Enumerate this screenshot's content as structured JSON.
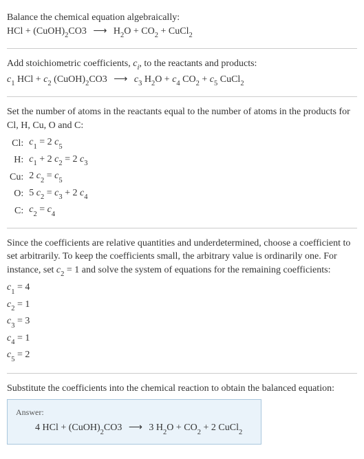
{
  "section1": {
    "line1": "Balance the chemical equation algebraically:"
  },
  "section2": {
    "line1_a": "Add stoichiometric coefficients, ",
    "line1_b": ", to the reactants and products:"
  },
  "section3": {
    "line1": "Set the number of atoms in the reactants equal to the number of atoms in the products for Cl, H, Cu, O and C:",
    "rows": [
      {
        "el": "Cl:",
        "eq_lhs": "c",
        "eq_s1": "1",
        "eq_mid": " = 2 ",
        "eq_rhs": "c",
        "eq_s2": "5"
      },
      {
        "el": "H:",
        "eq": "c1 + 2 c2 = 2 c3"
      },
      {
        "el": "Cu:",
        "eq": "2 c2 = c5"
      },
      {
        "el": "O:",
        "eq": "5 c2 = c3 + 2 c4"
      },
      {
        "el": "C:",
        "eq": "c2 = c4"
      }
    ]
  },
  "section4": {
    "line1_a": "Since the coefficients are relative quantities and underdetermined, choose a coefficient to set arbitrarily. To keep the coefficients small, the arbitrary value is ordinarily one. For instance, set ",
    "line1_b": " = 1 and solve the system of equations for the remaining coefficients:",
    "coefs": [
      {
        "c": "c",
        "s": "1",
        "v": " = 4"
      },
      {
        "c": "c",
        "s": "2",
        "v": " = 1"
      },
      {
        "c": "c",
        "s": "3",
        "v": " = 3"
      },
      {
        "c": "c",
        "s": "4",
        "v": " = 1"
      },
      {
        "c": "c",
        "s": "5",
        "v": " = 2"
      }
    ]
  },
  "section5": {
    "line1": "Substitute the coefficients into the chemical reaction to obtain the balanced equation:",
    "answer_label": "Answer:"
  },
  "chem": {
    "HCl_a": "HCl + (CuOH)",
    "HCl_b": "2",
    "HCl_c": "CO3",
    "arrow": "⟶",
    "H2O_a": "H",
    "H2O_b": "2",
    "H2O_c": "O + CO",
    "H2O_d": "2",
    "H2O_e": " + CuCl",
    "H2O_f": "2",
    "c1": "c",
    "s1": "1",
    "sp1": " HCl + ",
    "c2": "c",
    "s2": "2",
    "sp2": " (CuOH)",
    "sp2b": "2",
    "sp2c": "CO3",
    "c3": "c",
    "s3": "3",
    "sp3": " H",
    "sp3b": "2",
    "sp3c": "O + ",
    "c4": "c",
    "s4": "4",
    "sp4": " CO",
    "sp4b": "2",
    "sp4c": " + ",
    "c5": "c",
    "s5": "5",
    "sp5": " CuCl",
    "sp5b": "2",
    "ci": "c",
    "si": "i",
    "c2lbl": "c",
    "s2lbl": "2",
    "ans_a": "4 HCl + (CuOH)",
    "ans_b": "2",
    "ans_c": "CO3",
    "ans_d": "3 H",
    "ans_e": "2",
    "ans_f": "O + CO",
    "ans_g": "2",
    "ans_h": " + 2 CuCl",
    "ans_i": "2"
  },
  "eqrows": {
    "r0e": "Cl:",
    "r0a": "c",
    "r0b": "1",
    "r0c": " = 2 ",
    "r0d": "c",
    "r0f": "5",
    "r1e": "H:",
    "r1a": "c",
    "r1b": "1",
    "r1c": " + 2 ",
    "r1d": "c",
    "r1f": "2",
    "r1g": " = 2 ",
    "r1h": "c",
    "r1i": "3",
    "r2e": "Cu:",
    "r2a": "2 ",
    "r2b": "c",
    "r2c": "2",
    "r2d": " = ",
    "r2f": "c",
    "r2g": "5",
    "r3e": "O:",
    "r3a": "5 ",
    "r3b": "c",
    "r3c": "2",
    "r3d": " = ",
    "r3f": "c",
    "r3g": "3",
    "r3h": " + 2 ",
    "r3i": "c",
    "r3j": "4",
    "r4e": "C:",
    "r4a": "c",
    "r4b": "2",
    "r4c": " = ",
    "r4d": "c",
    "r4f": "4"
  }
}
